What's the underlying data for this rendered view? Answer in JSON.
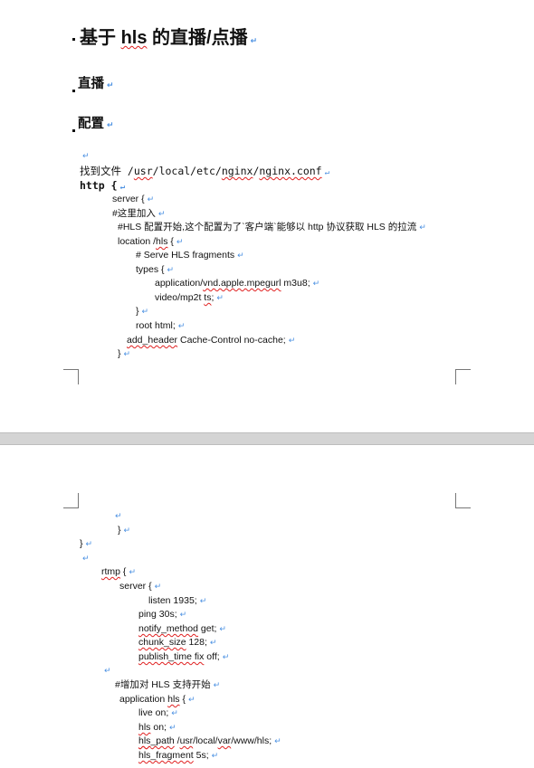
{
  "document": {
    "title": "基于 hls 的直播/点播",
    "title_misspelled": [
      "hls"
    ],
    "heading_live": "直播",
    "heading_config": "配置",
    "return_mark": "↵",
    "page1_lines": [
      {
        "t": "",
        "u": []
      },
      {
        "t": "找到文件 /usr/local/etc/nginx/nginx.conf",
        "u": [
          "usr",
          "nginx",
          "nginx.conf"
        ]
      },
      {
        "t": "http {",
        "u": []
      },
      {
        "t": "server {",
        "u": []
      },
      {
        "t": "#这里加入",
        "u": []
      },
      {
        "t": "#HLS 配置开始,这个配置为了`客户端`能够以 http 协议获取 HLS 的拉流",
        "u": []
      },
      {
        "t": "location /hls {",
        "u": [
          "hls"
        ]
      },
      {
        "t": "# Serve HLS fragments",
        "u": []
      },
      {
        "t": "types {",
        "u": []
      },
      {
        "t": "application/vnd.apple.mpegurl m3u8;",
        "u": [
          "vnd.apple.mpegurl"
        ]
      },
      {
        "t": "video/mp2t ts;",
        "u": [
          "ts"
        ]
      },
      {
        "t": "}",
        "u": []
      },
      {
        "t": "root html;",
        "u": []
      },
      {
        "t": "add_header Cache-Control no-cache;",
        "u": [
          "add_header"
        ]
      },
      {
        "t": "}",
        "u": []
      }
    ],
    "page2_lines": [
      {
        "t": "",
        "u": []
      },
      {
        "t": "}",
        "u": []
      },
      {
        "t": "}",
        "u": []
      },
      {
        "t": "",
        "u": []
      },
      {
        "t": "rtmp {",
        "u": [
          "rtmp"
        ]
      },
      {
        "t": "server {",
        "u": []
      },
      {
        "t": "listen 1935;",
        "u": []
      },
      {
        "t": "ping 30s;",
        "u": []
      },
      {
        "t": "notify_method get;",
        "u": [
          "notify_method"
        ]
      },
      {
        "t": "chunk_size 128;",
        "u": [
          "chunk_size"
        ]
      },
      {
        "t": "publish_time fix off;",
        "u": [
          "publish_time fix"
        ]
      },
      {
        "t": "",
        "u": []
      },
      {
        "t": "#增加对 HLS 支持开始",
        "u": []
      },
      {
        "t": "application hls {",
        "u": [
          "hls"
        ]
      },
      {
        "t": "live on;",
        "u": []
      },
      {
        "t": "hls on;",
        "u": [
          "hls"
        ]
      },
      {
        "t": "hls_path /usr/local/var/www/hls;",
        "u": [
          "hls_path",
          "usr",
          "var",
          "hls"
        ]
      },
      {
        "t": "hls_fragment 5s;",
        "u": [
          "hls_fragment"
        ]
      }
    ]
  },
  "colors": {
    "return_mark": "#4a90e2",
    "spellcheck": "#e02020",
    "page_gap": "#d4d4d4"
  }
}
